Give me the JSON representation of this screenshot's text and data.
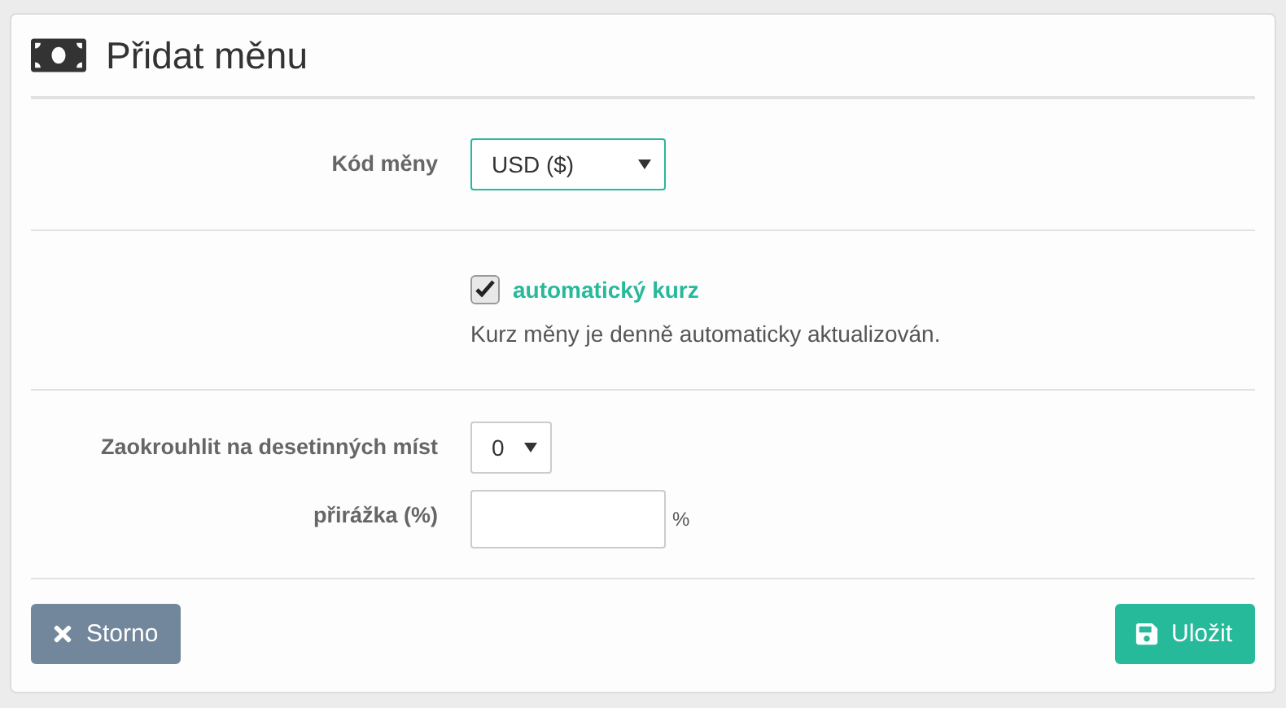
{
  "title": "Přidat měnu",
  "currency": {
    "label": "Kód měny",
    "value": "USD ($)",
    "focused": true
  },
  "auto_rate": {
    "label": "automatický kurz",
    "checked": true,
    "help": "Kurz měny je denně automaticky aktualizován."
  },
  "rounding": {
    "label": "Zaokrouhlit na desetinných míst",
    "value": "0"
  },
  "markup": {
    "label": "přirážka (%)",
    "unit": "%"
  },
  "buttons": [
    {
      "kind": "cancel",
      "label": "Storno"
    },
    {
      "kind": "save",
      "label": "Uložit"
    }
  ]
}
